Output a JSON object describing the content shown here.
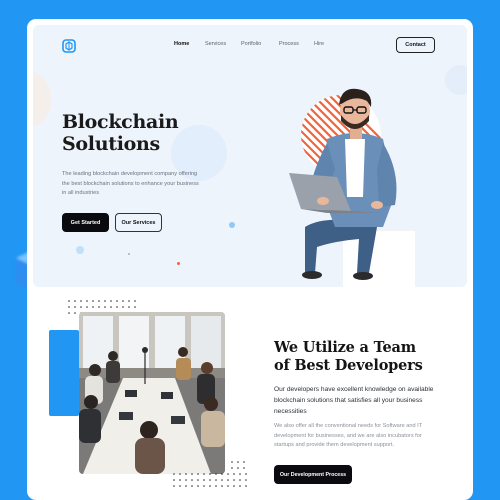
{
  "nav": {
    "items": [
      {
        "label": "Home",
        "active": true
      },
      {
        "label": "Services",
        "active": false
      },
      {
        "label": "Portfolio",
        "active": false
      },
      {
        "label": "Process",
        "active": false
      },
      {
        "label": "Hire",
        "active": false
      }
    ],
    "contact_label": "Contact"
  },
  "hero": {
    "title_line1": "Blockchain",
    "title_line2": "Solutions",
    "description": "The leading blockchain development company offering the best blockchain solutions to enhance your business in all industries",
    "primary_button": "Get Started",
    "secondary_button": "Our Services"
  },
  "section2": {
    "title_line1": "We Utilize a Team",
    "title_line2": "of Best Developers",
    "description_primary": "Our  developers have excellent knowledge on available blockchain solutions that satisfies all your business necessities",
    "description_secondary": "We also offer all the conventional needs for Software and IT development for businesses, and we are also incubators for startups and provide them development support.",
    "button_label": "Our Development Process"
  },
  "colors": {
    "brand_blue": "#2196f3",
    "hero_bg": "#eef4fb",
    "dark": "#0b0b0f",
    "accent_orange": "#f4643a"
  },
  "icons": [
    "logo-icon",
    "cube-decoration-icon"
  ]
}
